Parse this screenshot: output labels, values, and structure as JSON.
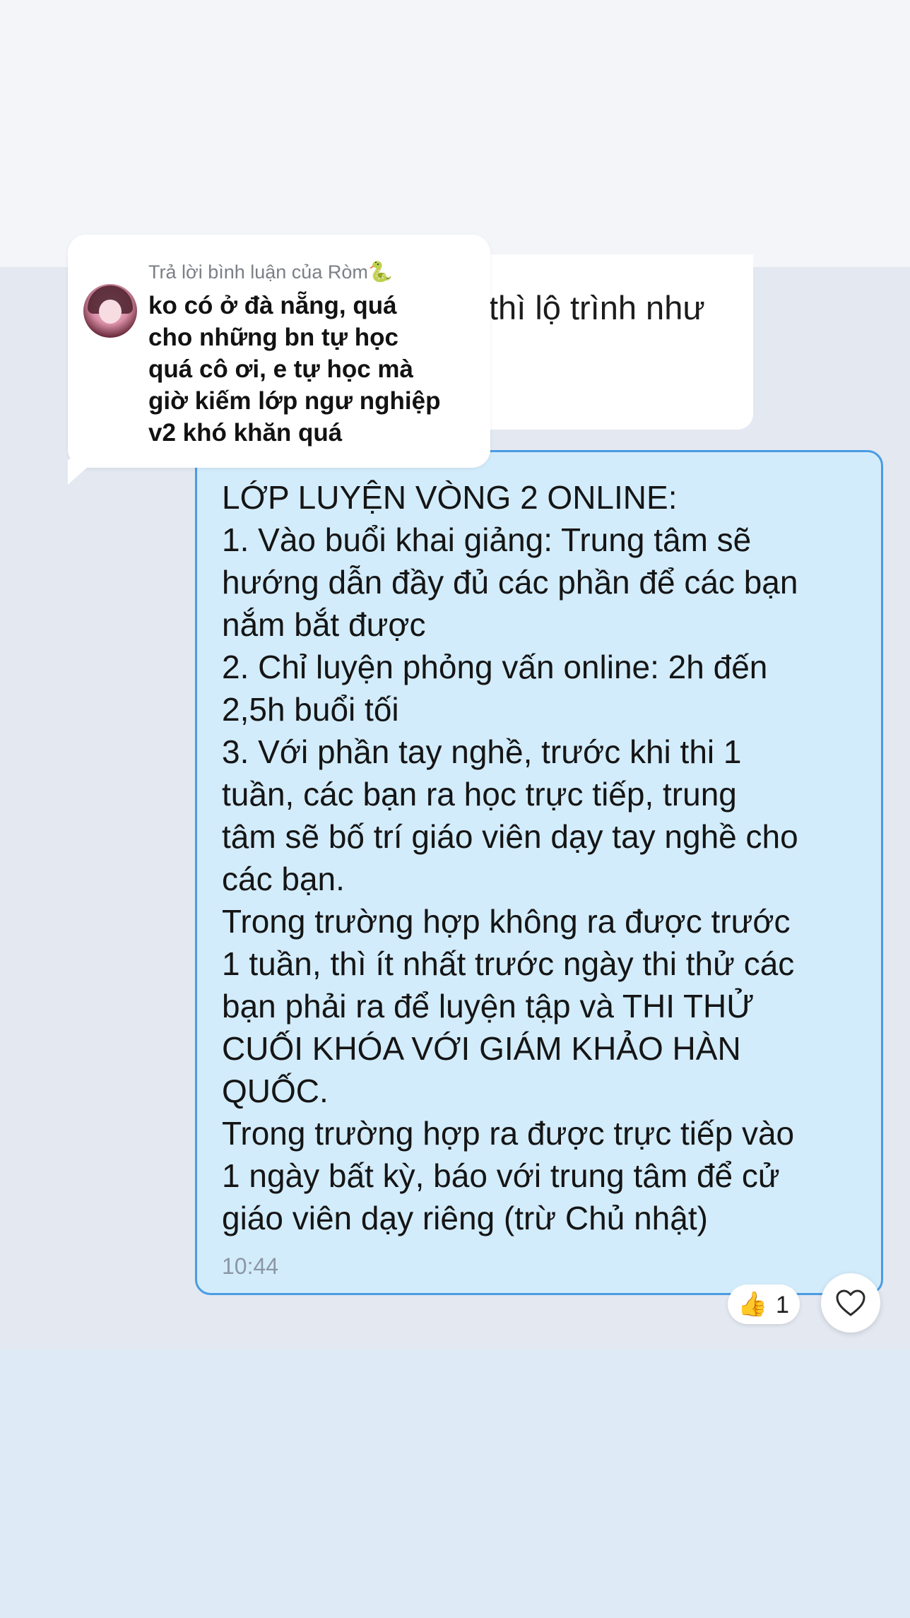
{
  "reply_preview": {
    "label": "Trả lời bình luận của Ròm",
    "label_emoji": "🐍",
    "comment_text": "ko có ở đà nẵng, quá\ncho những bn tự học\nquá cô ơi, e tự học mà\ngiờ kiếm lớp ngư nghiệp\nv2 khó khăn quá"
  },
  "previous_message": {
    "text_fragment": "thì lộ trình như"
  },
  "message": {
    "text": "LỚP LUYỆN VÒNG 2 ONLINE:\n1. Vào buổi khai giảng: Trung tâm sẽ\nhướng dẫn đầy đủ các phần để các bạn\nnắm bắt được\n2. Chỉ luyện phỏng vấn online: 2h đến\n2,5h buổi tối\n3. Với phần tay nghề, trước khi thi 1\ntuần, các bạn ra học trực tiếp, trung\ntâm sẽ bố trí giáo viên dạy tay nghề cho\ncác bạn.\nTrong trường hợp không ra được trước\n1 tuần, thì ít nhất trước ngày thi thử các\nbạn phải ra để luyện tập và THI THỬ\nCUỐI KHÓA VỚI GIÁM KHẢO HÀN\nQUỐC.\nTrong trường hợp ra được trực tiếp vào\n1 ngày bất kỳ, báo với trung tâm để cử\ngiáo viên dạy riêng (trừ Chủ nhật)",
    "time": "10:44"
  },
  "reactions": {
    "emoji": "👍",
    "count": "1"
  },
  "icons": {
    "avatar": "user-avatar",
    "reaction": "thumbs-up-icon",
    "like": "heart-icon"
  },
  "colors": {
    "bubble_fill": "#d3ecfb",
    "bubble_border": "#4a9be3",
    "chat_background": "#e3e8f1"
  }
}
